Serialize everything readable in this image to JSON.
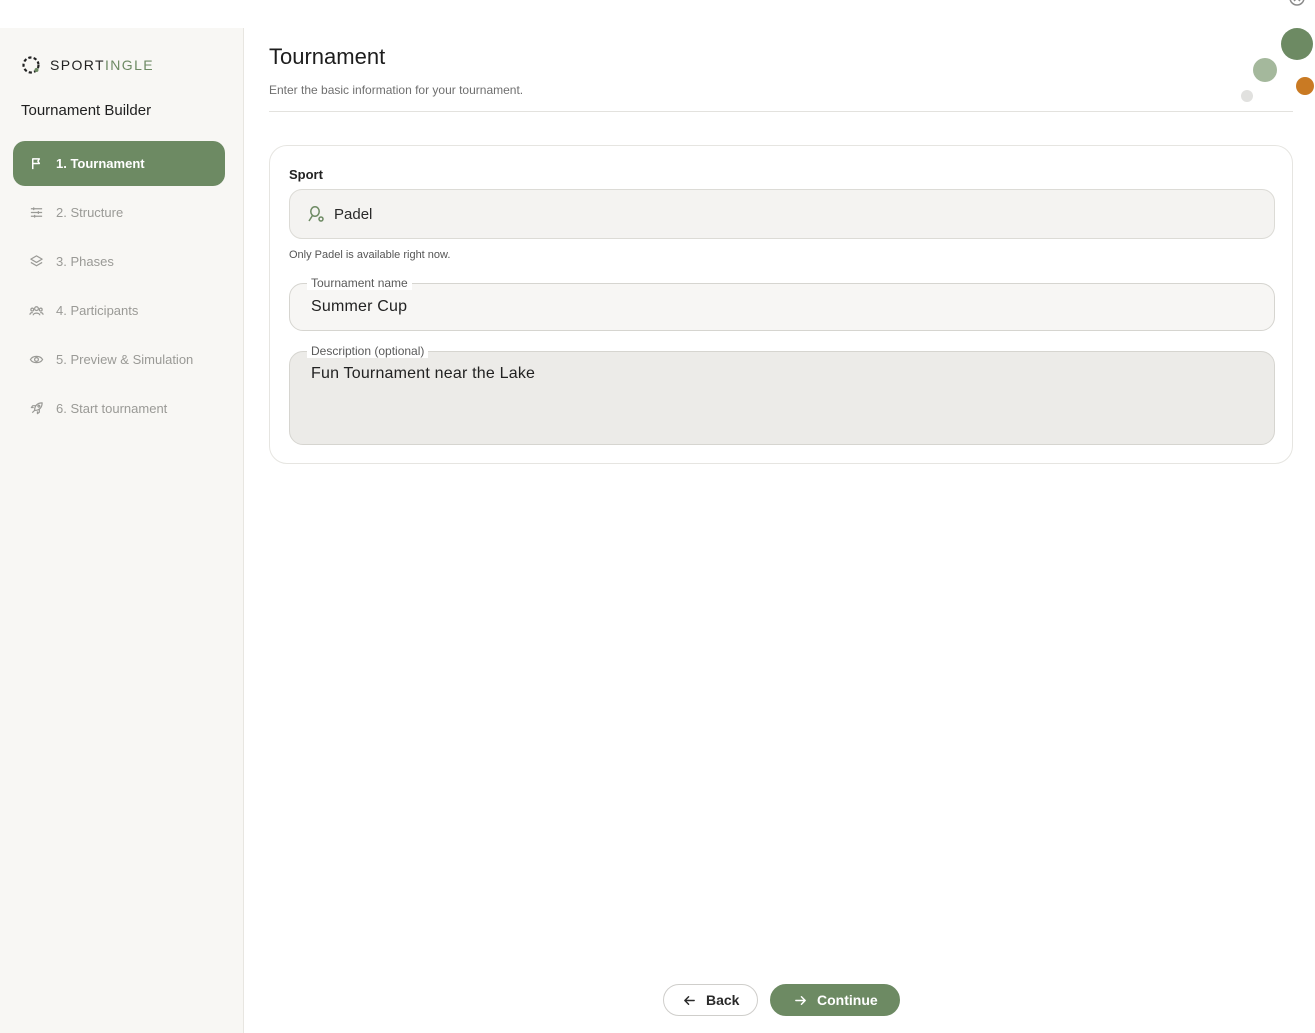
{
  "brand": {
    "name_part1": "SPORT",
    "name_part2": "INGLE",
    "accent_color": "#6d8a63",
    "logo_icon": "sportingle-logo-icon"
  },
  "sidebar": {
    "title": "Tournament Builder",
    "items": [
      {
        "label": "1. Tournament",
        "icon": "flag-icon",
        "active": true
      },
      {
        "label": "2. Structure",
        "icon": "sliders-icon",
        "active": false
      },
      {
        "label": "3. Phases",
        "icon": "layers-icon",
        "active": false
      },
      {
        "label": "4. Participants",
        "icon": "users-icon",
        "active": false
      },
      {
        "label": "5. Preview & Simulation",
        "icon": "eye-icon",
        "active": false
      },
      {
        "label": "6. Start tournament",
        "icon": "rocket-icon",
        "active": false
      }
    ]
  },
  "header": {
    "title": "Tournament",
    "subtitle": "Enter the basic information for your tournament."
  },
  "form": {
    "sport_label": "Sport",
    "sport_value": "Padel",
    "sport_icon": "padel-racket-icon",
    "sport_hint": "Only Padel is available right now.",
    "name_label": "Tournament name",
    "name_value": "Summer Cup",
    "description_label": "Description (optional)",
    "description_value": "Fun Tournament near the Lake"
  },
  "footer": {
    "back_label": "Back",
    "continue_label": "Continue"
  },
  "decor_colors": [
    "#6d8a63",
    "#a4b89c",
    "#c97a23",
    "#e1e1df"
  ]
}
